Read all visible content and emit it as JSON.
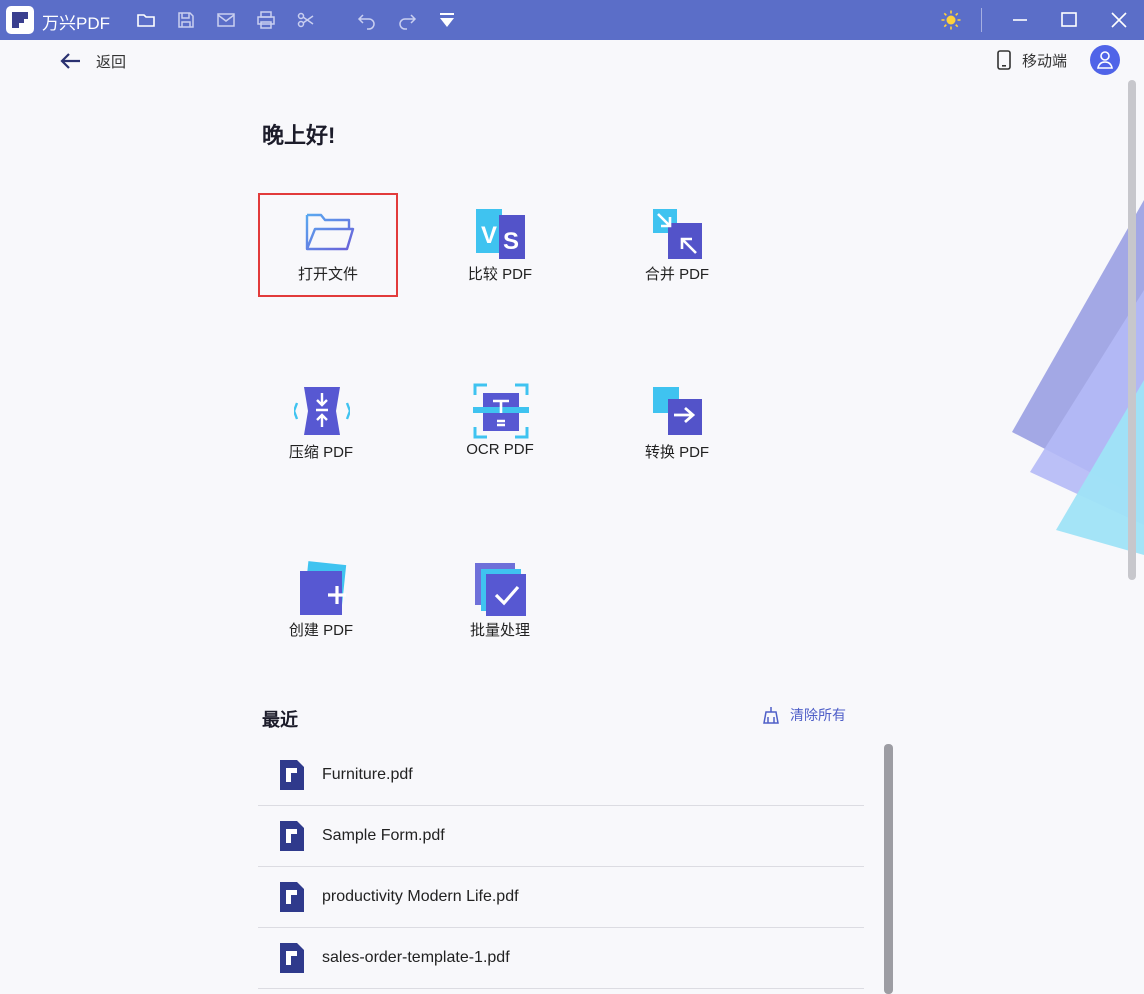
{
  "app": {
    "name": "万兴PDF"
  },
  "header": {
    "back_label": "返回",
    "mobile_label": "移动端"
  },
  "greeting": "晚上好!",
  "tools": [
    {
      "id": "open",
      "label": "打开文件",
      "icon": "folder-icon",
      "selected": true
    },
    {
      "id": "compare",
      "label": "比较 PDF",
      "icon": "compare-icon"
    },
    {
      "id": "merge",
      "label": "合并 PDF",
      "icon": "merge-icon"
    },
    {
      "id": "compress",
      "label": "压缩 PDF",
      "icon": "compress-icon"
    },
    {
      "id": "ocr",
      "label": "OCR PDF",
      "icon": "ocr-icon"
    },
    {
      "id": "convert",
      "label": "转换 PDF",
      "icon": "convert-icon"
    },
    {
      "id": "create",
      "label": "创建 PDF",
      "icon": "create-icon"
    },
    {
      "id": "batch",
      "label": "批量处理",
      "icon": "batch-icon"
    }
  ],
  "recent": {
    "title": "最近",
    "clear_label": "清除所有",
    "files": [
      {
        "name": "Furniture.pdf"
      },
      {
        "name": "Sample Form.pdf"
      },
      {
        "name": "productivity Modern Life.pdf"
      },
      {
        "name": "sales-order-template-1.pdf"
      }
    ]
  },
  "colors": {
    "titlebar": "#5b6ec8",
    "accent": "#5064e8",
    "selection_outline": "#e23b3b"
  }
}
